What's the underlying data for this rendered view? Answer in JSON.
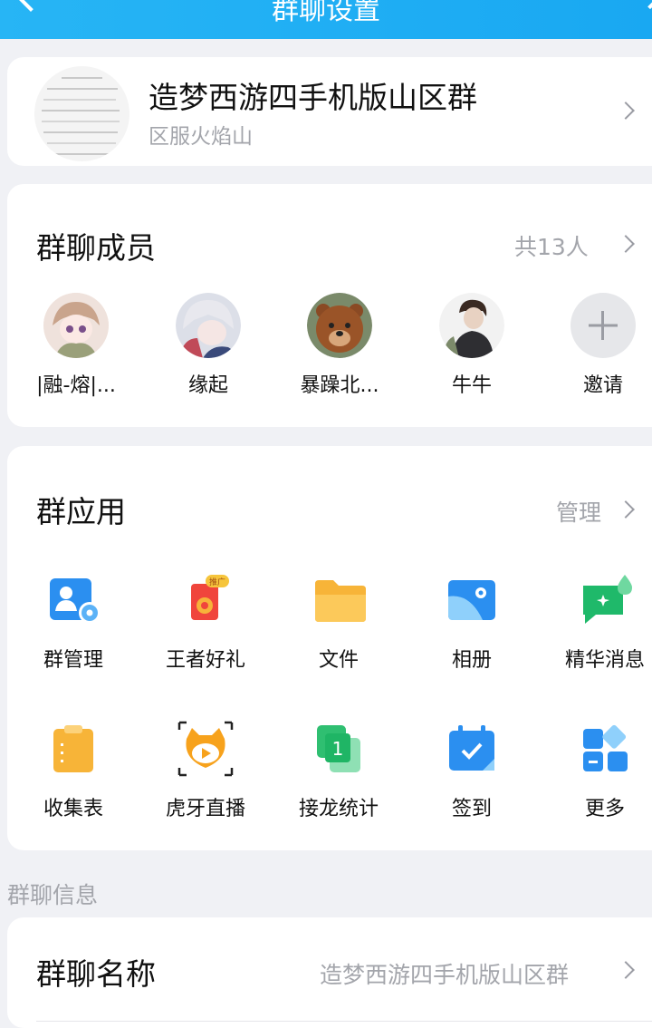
{
  "header": {
    "title": "群聊设置"
  },
  "group": {
    "name": "造梦西游四手机版山区群",
    "subtitle": "区服火焰山"
  },
  "members_section": {
    "title": "群聊成员",
    "count": "共13人",
    "members": [
      {
        "name": "|融-熔|..."
      },
      {
        "name": "缘起"
      },
      {
        "name": "暴躁北..."
      },
      {
        "name": "牛牛"
      },
      {
        "name": "邀请"
      }
    ]
  },
  "apps_section": {
    "title": "群应用",
    "manage": "管理",
    "apps": [
      {
        "label": "群管理",
        "icon": "group-manage-icon"
      },
      {
        "label": "王者好礼",
        "icon": "game-gift-icon",
        "badge": "推广"
      },
      {
        "label": "文件",
        "icon": "folder-icon"
      },
      {
        "label": "相册",
        "icon": "album-icon"
      },
      {
        "label": "精华消息",
        "icon": "essence-message-icon"
      },
      {
        "label": "收集表",
        "icon": "clipboard-icon"
      },
      {
        "label": "虎牙直播",
        "icon": "huya-live-icon"
      },
      {
        "label": "接龙统计",
        "icon": "solitaire-icon"
      },
      {
        "label": "签到",
        "icon": "checkin-calendar-icon"
      },
      {
        "label": "更多",
        "icon": "more-apps-icon"
      }
    ]
  },
  "info_section": {
    "label": "群聊信息",
    "name_row": {
      "label": "群聊名称",
      "value": "造梦西游四手机版山区群"
    }
  },
  "colors": {
    "accent": "#1aa9f2",
    "background": "#f0f1f5"
  }
}
